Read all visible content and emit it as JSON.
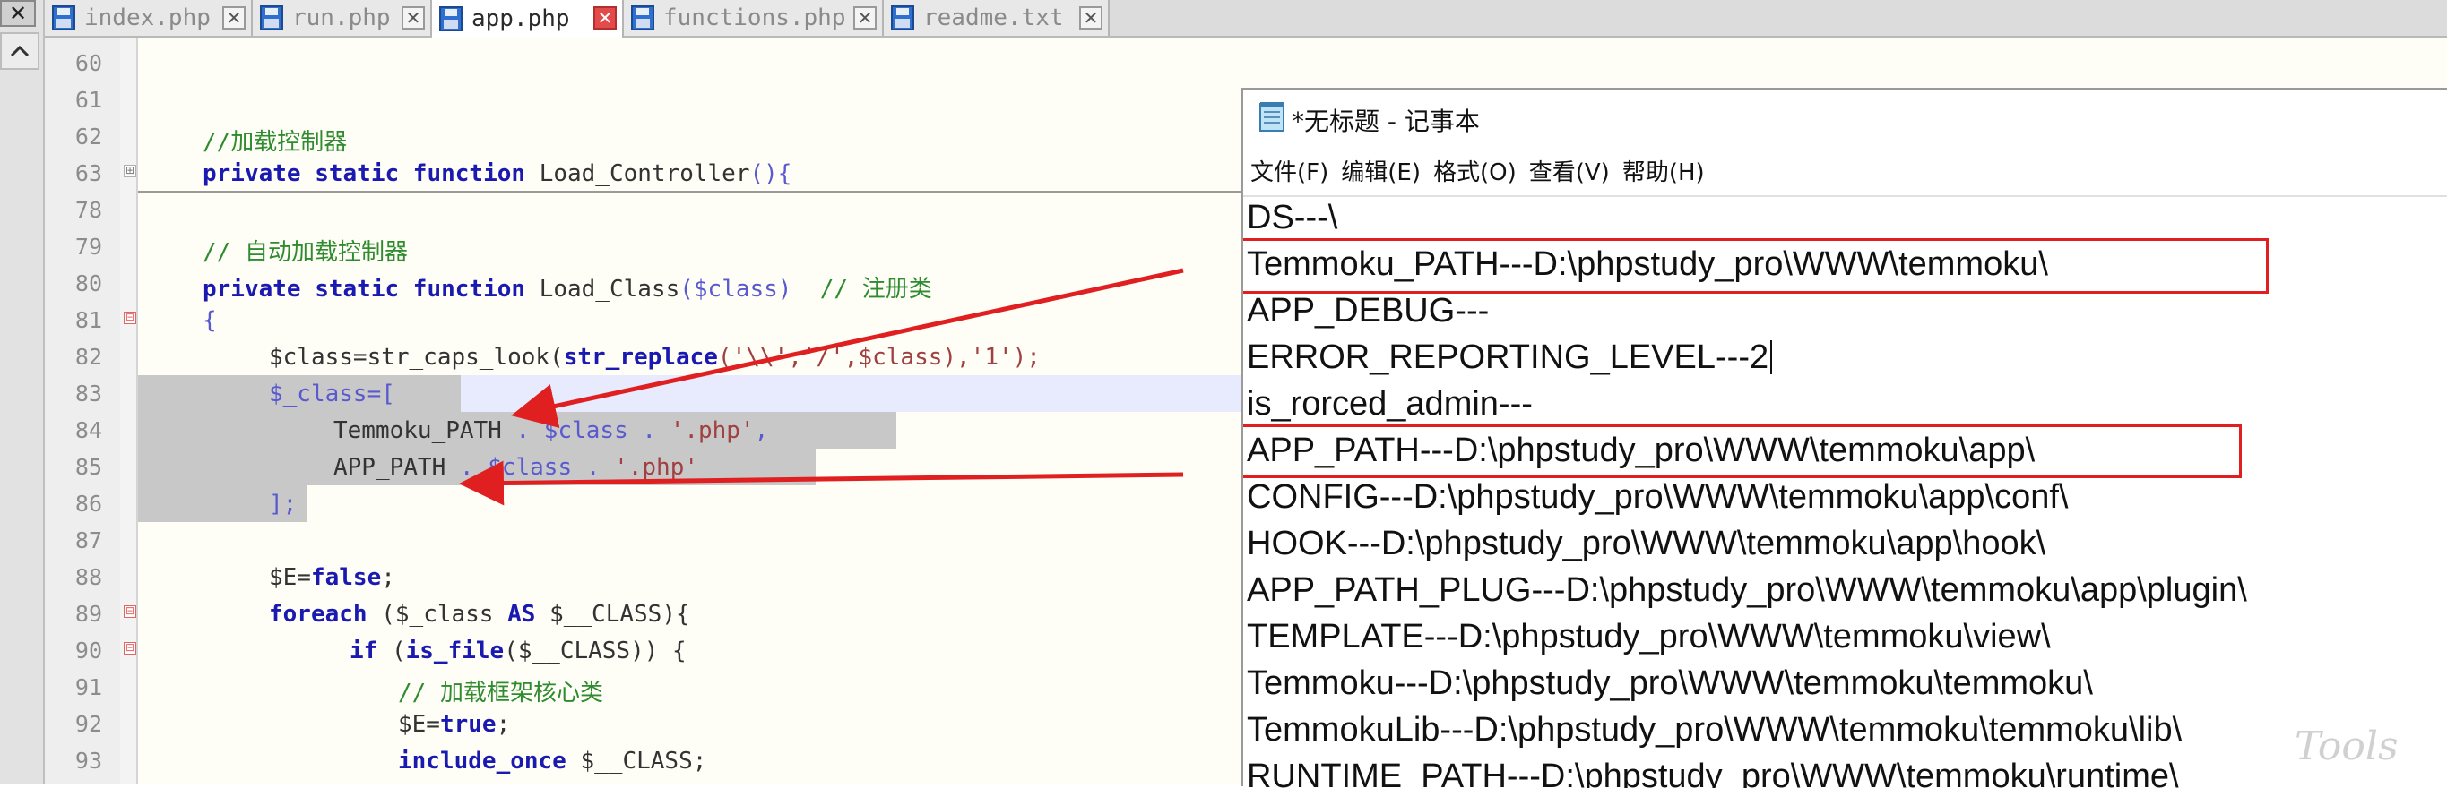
{
  "window": {
    "close_glyph": "✕"
  },
  "tabs": [
    {
      "label": "index.php",
      "active": false
    },
    {
      "label": "run.php",
      "active": false
    },
    {
      "label": "app.php",
      "active": true
    },
    {
      "label": "functions.php",
      "active": false
    },
    {
      "label": "readme.txt",
      "active": false
    }
  ],
  "editor": {
    "lines": [
      {
        "num": "60",
        "text": ""
      },
      {
        "num": "61",
        "text": ""
      },
      {
        "num": "62",
        "text": "//加载控制器"
      },
      {
        "num": "63",
        "kw1": "private static function",
        "name": "Load_Controller",
        "rest": "(){"
      },
      {
        "num": "78",
        "text": ""
      },
      {
        "num": "79",
        "text": "// 自动加载控制器"
      },
      {
        "num": "80",
        "kw1": "private static function",
        "name": "Load_Class",
        "rest": "($class)",
        "comment": "// 注册类"
      },
      {
        "num": "81",
        "text": "{"
      },
      {
        "num": "82",
        "a": "$class=str_caps_look(",
        "b": "str_replace",
        "c": "('\\\\','/',$class),'1');"
      },
      {
        "num": "83",
        "text": "$_class=["
      },
      {
        "num": "84",
        "a": "Temmoku_PATH",
        "b": " . $class . ",
        "c": "'.php'",
        "d": ","
      },
      {
        "num": "85",
        "a": "APP_PATH",
        "b": " . $class . ",
        "c": "'.php'"
      },
      {
        "num": "86",
        "text": "];"
      },
      {
        "num": "87",
        "text": ""
      },
      {
        "num": "88",
        "a": "$E=",
        "b": "false",
        "c": ";"
      },
      {
        "num": "89",
        "a": "foreach",
        "b": " ($_class ",
        "c": "AS",
        "d": " $__CLASS){"
      },
      {
        "num": "90",
        "a": "if",
        "b": " (",
        "c": "is_file",
        "d": "($__CLASS)) {"
      },
      {
        "num": "91",
        "text": "// 加载框架核心类"
      },
      {
        "num": "92",
        "a": "$E=",
        "b": "true",
        "c": ";"
      },
      {
        "num": "93",
        "a": "include_once",
        "b": " $__CLASS;"
      }
    ]
  },
  "notepad": {
    "title": "*无标题 - 记事本",
    "menu": [
      "文件(F)",
      "编辑(E)",
      "格式(O)",
      "查看(V)",
      "帮助(H)"
    ],
    "lines": [
      "DS---\\",
      "Temmoku_PATH---D:\\phpstudy_pro\\WWW\\temmoku\\",
      "APP_DEBUG---",
      "ERROR_REPORTING_LEVEL---2",
      "is_rorced_admin---",
      "APP_PATH---D:\\phpstudy_pro\\WWW\\temmoku\\app\\",
      "CONFIG---D:\\phpstudy_pro\\WWW\\temmoku\\app\\conf\\",
      "HOOK---D:\\phpstudy_pro\\WWW\\temmoku\\app\\hook\\",
      "APP_PATH_PLUG---D:\\phpstudy_pro\\WWW\\temmoku\\app\\plugin\\",
      "TEMPLATE---D:\\phpstudy_pro\\WWW\\temmoku\\view\\",
      "Temmoku---D:\\phpstudy_pro\\WWW\\temmoku\\temmoku\\",
      "TemmokuLib---D:\\phpstudy_pro\\WWW\\temmoku\\temmoku\\lib\\",
      "RUNTIME_PATH---D:\\phpstudy_pro\\WWW\\temmoku\\runtime\\"
    ]
  },
  "watermark": "Tools",
  "colors": {
    "annotation": "#e02020",
    "keyword": "#1a1ab0",
    "comment": "#2e8b2e"
  }
}
